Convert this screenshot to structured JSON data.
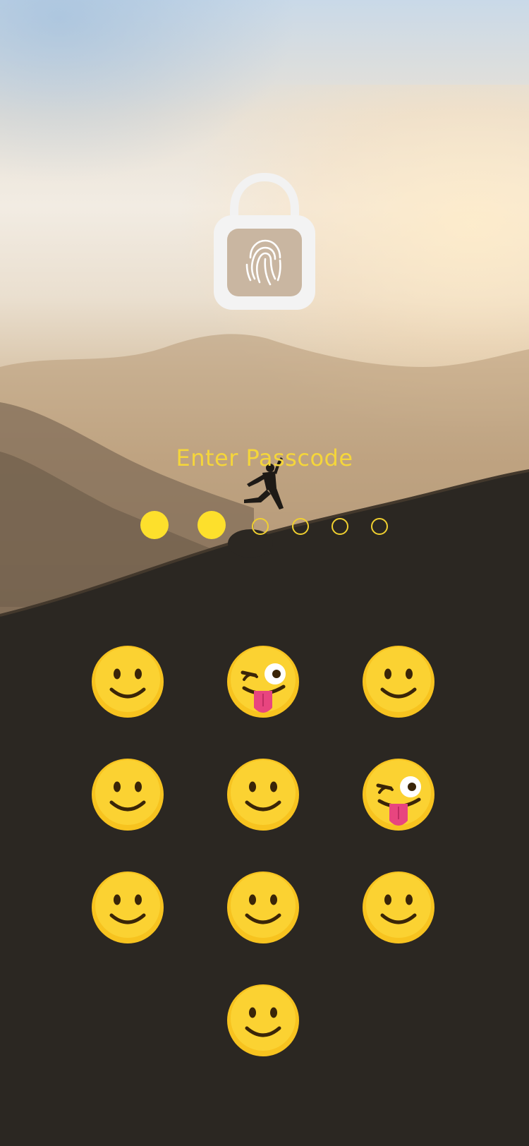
{
  "title": "Enter Passcode",
  "passcode": {
    "length": 6,
    "entered": 2
  },
  "keypad": {
    "keys": [
      {
        "id": 1,
        "icon": "smiley-face-icon"
      },
      {
        "id": 2,
        "icon": "winking-tongue-face-icon"
      },
      {
        "id": 3,
        "icon": "smiley-face-icon"
      },
      {
        "id": 4,
        "icon": "smiley-face-icon"
      },
      {
        "id": 5,
        "icon": "smiley-face-icon"
      },
      {
        "id": 6,
        "icon": "winking-tongue-face-icon"
      },
      {
        "id": 7,
        "icon": "smiley-face-icon"
      },
      {
        "id": 8,
        "icon": "smiley-face-icon"
      },
      {
        "id": 9,
        "icon": "smiley-face-icon"
      },
      {
        "id": 0,
        "icon": "smiley-face-icon"
      }
    ]
  },
  "lock_icon": "fingerprint-padlock-icon",
  "colors": {
    "accent": "#FDE02C",
    "emoji": "#F7C31F",
    "tongue": "#E8457F"
  }
}
